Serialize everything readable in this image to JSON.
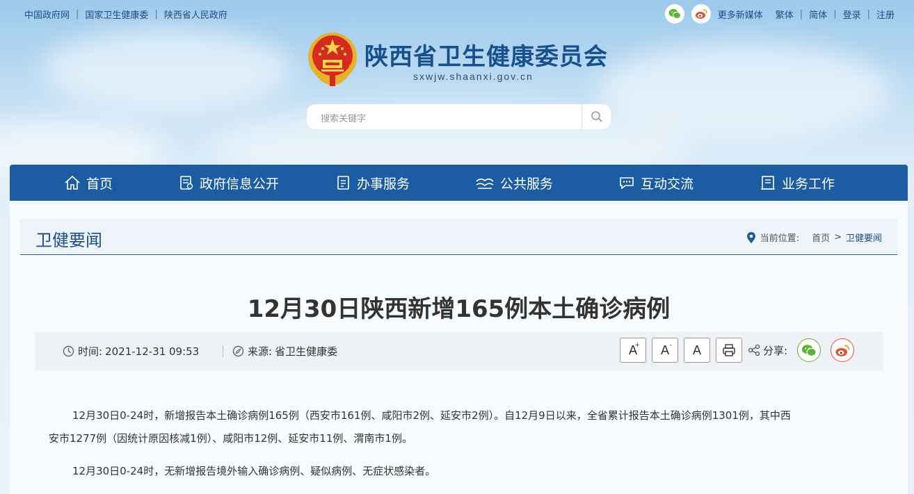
{
  "topbar": {
    "links": [
      "中国政府网",
      "国家卫生健康委",
      "陕西省人民政府"
    ],
    "more_media": "更多新媒体",
    "traditional": "繁体",
    "simplified": "简体",
    "login": "登录",
    "register": "注册"
  },
  "site": {
    "title": "陕西省卫生健康委员会",
    "domain": "sxwjw.shaanxi.gov.cn"
  },
  "search": {
    "placeholder": "搜索关键字"
  },
  "nav": [
    "首页",
    "政府信息公开",
    "办事服务",
    "公共服务",
    "互动交流",
    "业务工作"
  ],
  "section": {
    "title": "卫健要闻",
    "location_label": "当前位置:",
    "crumbs": [
      "首页",
      "卫健要闻"
    ],
    "crumb_sep": ">"
  },
  "article": {
    "title": "12月30日陕西新增165例本土确诊病例",
    "time_label": "时间:",
    "time": "2021-12-31 09:53",
    "source_label": "来源:",
    "source": "省卫生健康委",
    "font_buttons": [
      "A",
      "A",
      "A"
    ],
    "share_label": "分享:",
    "paragraphs": [
      "12月30日0-24时，新增报告本土确诊病例165例（西安市161例、咸阳市2例、延安市2例）。自12月9日以来，全省累计报告本土确诊病例1301例，其中西",
      "安市1277例（因统计原因核减1例）、咸阳市12例、延安市11例、渭南市1例。",
      "12月30日0-24时，无新增报告境外输入确诊病例、疑似病例、无症状感染者。"
    ]
  },
  "colors": {
    "brand": "#1c5ca2",
    "wechat": "#5cb531",
    "weibo": "#e6512f"
  }
}
